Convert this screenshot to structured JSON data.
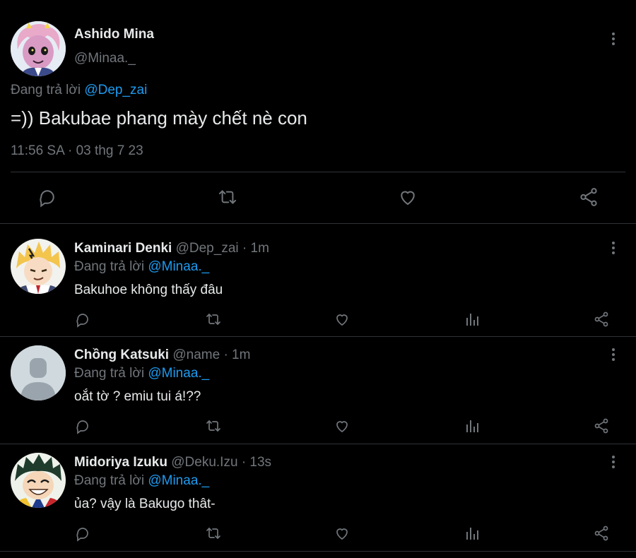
{
  "main_tweet": {
    "display_name": "Ashido Mina",
    "handle": "@Minaa._",
    "replying_prefix": "Đang trả lời",
    "replying_to": "@Dep_zai",
    "text": "=)) Bakubae phang mày chết nè con",
    "timestamp": "11:56 SA · 03 thg 7 23",
    "actions": [
      "reply-icon",
      "retweet-icon",
      "like-icon",
      "share-icon"
    ]
  },
  "replies": [
    {
      "display_name": "Kaminari Denki",
      "handle": "@Dep_zai",
      "time": "· 1m",
      "replying_prefix": "Đang trả lời",
      "replying_to": "@Minaa._",
      "text": "Bakuhoe không thấy đâu"
    },
    {
      "display_name": "Chồng Katsuki",
      "handle": "@name",
      "time": "· 1m",
      "replying_prefix": "Đang trả lời",
      "replying_to": "@Minaa._",
      "text": "oắt tờ ? emiu tui á!??"
    },
    {
      "display_name": "Midoriya Izuku",
      "handle": "@Deku.Izu",
      "time": "· 13s",
      "replying_prefix": "Đang trả lời",
      "replying_to": "@Minaa._",
      "text": "ủa? vậy là Bakugo thât-"
    }
  ],
  "colors": {
    "background": "#000000",
    "text": "#e7e9ea",
    "muted": "#71767b",
    "accent": "#1d9bf0",
    "divider": "#2f3336"
  }
}
